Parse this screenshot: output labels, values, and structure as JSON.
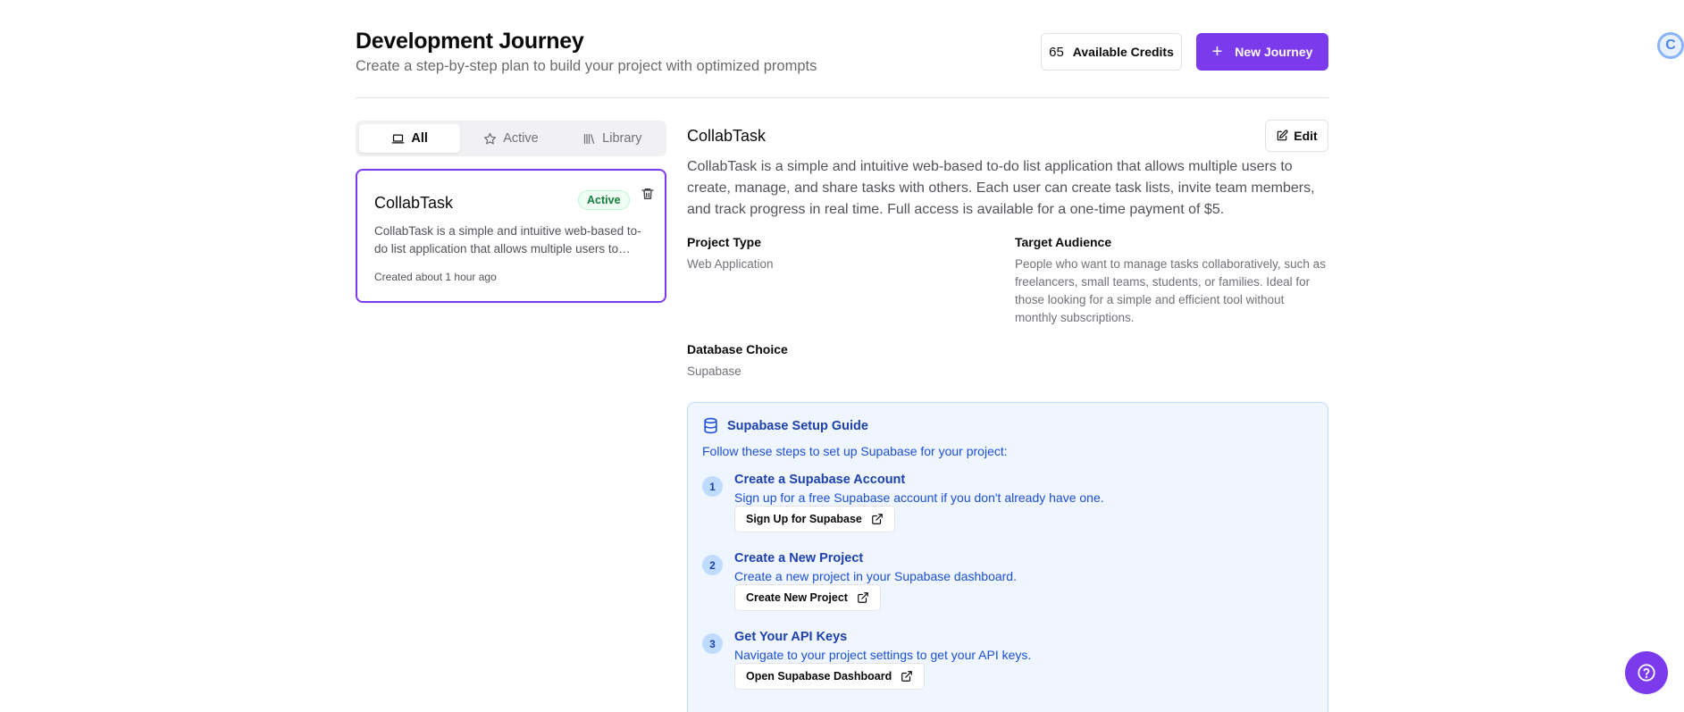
{
  "header": {
    "title": "Development Journey",
    "subtitle": "Create a step-by-step plan to build your project with optimized prompts",
    "credits_value": "65",
    "credits_label": "Available Credits",
    "new_journey_label": "New Journey"
  },
  "tabs": [
    {
      "label": "All",
      "active": true
    },
    {
      "label": "Active",
      "active": false
    },
    {
      "label": "Library",
      "active": false
    }
  ],
  "journey_card": {
    "title": "CollabTask",
    "badge": "Active",
    "description": "CollabTask is a simple and intuitive web-based to-do list application that allows multiple users to create, manage, and share tasks with others.",
    "created": "Created about 1 hour ago"
  },
  "detail": {
    "title": "CollabTask",
    "edit_label": "Edit",
    "description": "CollabTask is a simple and intuitive web-based to-do list application that allows multiple users to create, manage, and share tasks with others. Each user can create task lists, invite team members, and track progress in real time. Full access is available for a one-time payment of $5.",
    "project_type_label": "Project Type",
    "project_type_value": "Web Application",
    "target_audience_label": "Target Audience",
    "target_audience_value": "People who want to manage tasks collaboratively, such as freelancers, small teams, students, or families. Ideal for those looking for a simple and efficient tool without monthly subscriptions.",
    "database_label": "Database Choice",
    "database_value": "Supabase"
  },
  "guide": {
    "title": "Supabase Setup Guide",
    "intro": "Follow these steps to set up Supabase for your project:",
    "steps": [
      {
        "num": "1",
        "title": "Create a Supabase Account",
        "text": "Sign up for a free Supabase account if you don't already have one.",
        "button": "Sign Up for Supabase"
      },
      {
        "num": "2",
        "title": "Create a New Project",
        "text": "Create a new project in your Supabase dashboard.",
        "button": "Create New Project"
      },
      {
        "num": "3",
        "title": "Get Your API Keys",
        "text": "Navigate to your project settings to get your API keys.",
        "button": "Open Supabase Dashboard"
      }
    ]
  },
  "colors": {
    "accent": "#7c3aed",
    "guide_bg": "#eff6ff",
    "guide_text": "#1e40af",
    "badge_green": "#15803d"
  },
  "icons": [
    "plus-icon",
    "laptop-icon",
    "star-icon",
    "library-icon",
    "trash-icon",
    "edit-icon",
    "database-icon",
    "external-link-icon",
    "help-icon"
  ]
}
